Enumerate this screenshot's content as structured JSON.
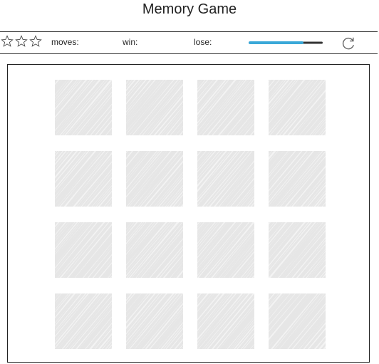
{
  "header": {
    "title": "Memory Game"
  },
  "scorebar": {
    "stars": [
      "empty-star-icon",
      "empty-star-icon",
      "empty-star-icon"
    ],
    "moves_label": "moves:",
    "win_label": "win:",
    "lose_label": "lose:",
    "timer_remaining_fraction": 0.74,
    "timer_color": "#3aa8d8",
    "timer_track_color": "#333333",
    "restart_icon": "restart-icon"
  },
  "board": {
    "rows": 4,
    "cols": 4,
    "cards": [
      {
        "state": "face-down"
      },
      {
        "state": "face-down"
      },
      {
        "state": "face-down"
      },
      {
        "state": "face-down"
      },
      {
        "state": "face-down"
      },
      {
        "state": "face-down"
      },
      {
        "state": "face-down"
      },
      {
        "state": "face-down"
      },
      {
        "state": "face-down"
      },
      {
        "state": "face-down"
      },
      {
        "state": "face-down"
      },
      {
        "state": "face-down"
      },
      {
        "state": "face-down"
      },
      {
        "state": "face-down"
      },
      {
        "state": "face-down"
      },
      {
        "state": "face-down"
      }
    ],
    "card_hatch_color": "#e6e6e6"
  }
}
